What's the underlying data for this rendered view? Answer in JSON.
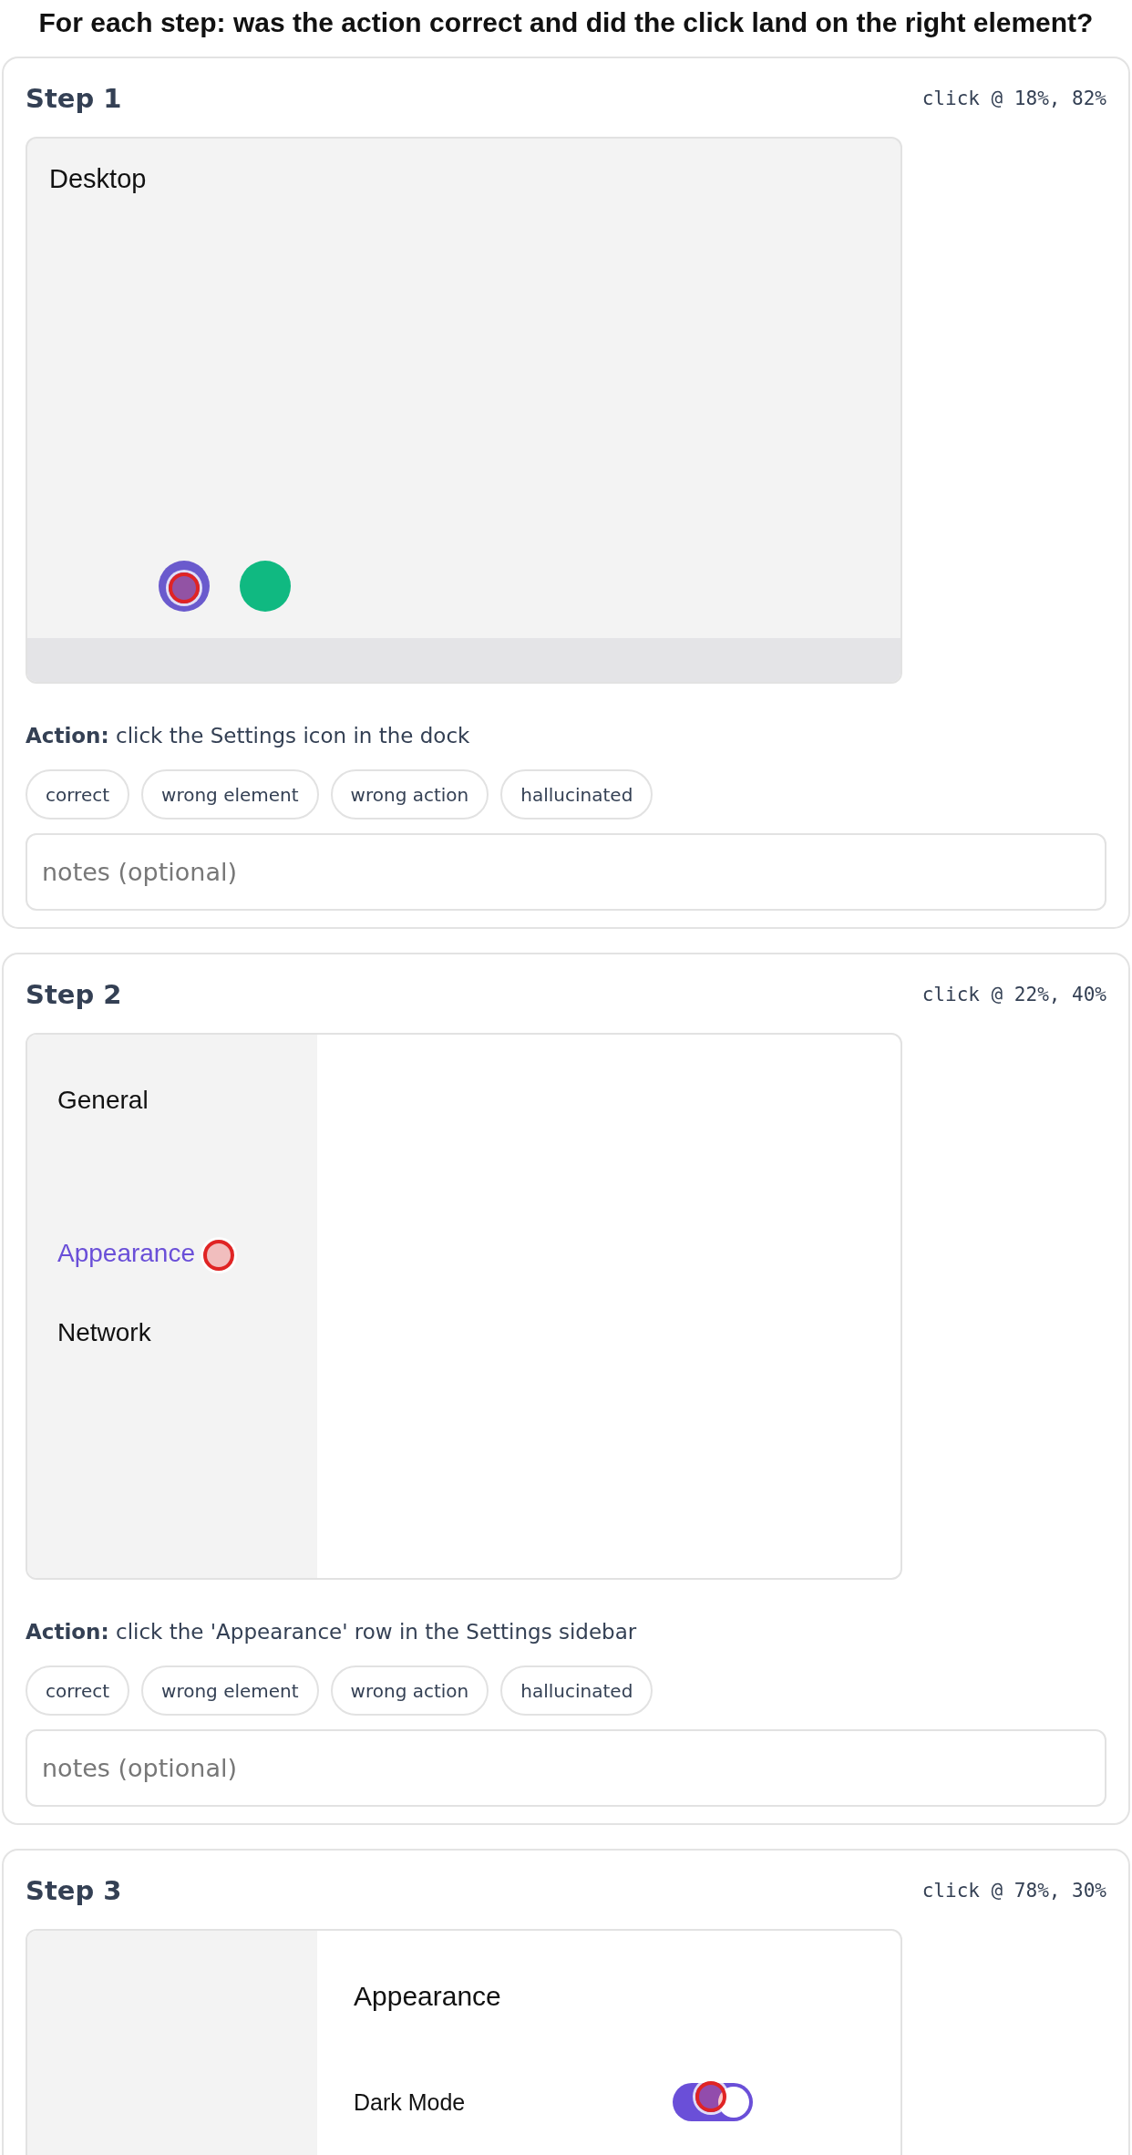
{
  "title": "For each step: was the action correct and did the click land on the right element?",
  "steps": [
    {
      "label": "Step 1",
      "click": "click @ 18%, 82%",
      "screen": {
        "kind": "desktop",
        "title": "Desktop",
        "dock": [
          {
            "color": "#6a5acd"
          },
          {
            "color": "#10b981"
          }
        ]
      },
      "action": "**Action:** click the Settings icon in the dock",
      "chips": [
        {
          "label": "correct",
          "selected": false
        },
        {
          "label": "wrong element",
          "selected": false
        },
        {
          "label": "wrong action",
          "selected": false
        },
        {
          "label": "hallucinated",
          "selected": false
        }
      ],
      "notes": {
        "placeholder": "notes (optional)"
      }
    },
    {
      "label": "Step 2",
      "click": "click @ 22%, 40%",
      "screen": {
        "kind": "sidebar",
        "items": [
          {
            "label": "General",
            "selected": false
          },
          {
            "label": "Appearance",
            "selected": true
          },
          {
            "label": "Network",
            "selected": false
          }
        ]
      },
      "action": "**Action:** click the 'Appearance' row in the Settings sidebar",
      "chips": [
        {
          "label": "correct",
          "selected": false
        },
        {
          "label": "wrong element",
          "selected": false
        },
        {
          "label": "wrong action",
          "selected": false
        },
        {
          "label": "hallucinated",
          "selected": false
        }
      ],
      "notes": {
        "placeholder": "notes (optional)"
      }
    },
    {
      "label": "Step 3",
      "click": "click @ 78%, 30%",
      "screen": {
        "kind": "panel",
        "heading": "Appearance",
        "rows": [
          {
            "label": "Dark Mode",
            "on": true
          }
        ]
      }
    }
  ]
}
